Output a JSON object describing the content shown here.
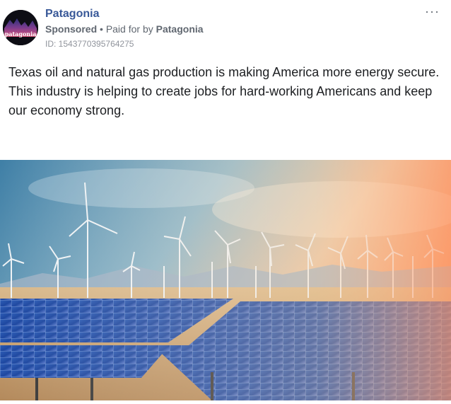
{
  "advertiser": {
    "name": "Patagonia",
    "logo_text": "patagonia",
    "sponsored_label": "Sponsored",
    "separator": "•",
    "paid_for_prefix": "Paid for by",
    "paid_for_name": "Patagonia",
    "ad_id": "ID: 1543770395764275"
  },
  "menu": {
    "more_label": "···"
  },
  "post": {
    "text": "Texas oil and natural gas production is making America more energy secure. This industry is helping to create jobs for hard-working Americans and keep our economy strong."
  },
  "media": {
    "icon": "renewable-energy-photo"
  }
}
